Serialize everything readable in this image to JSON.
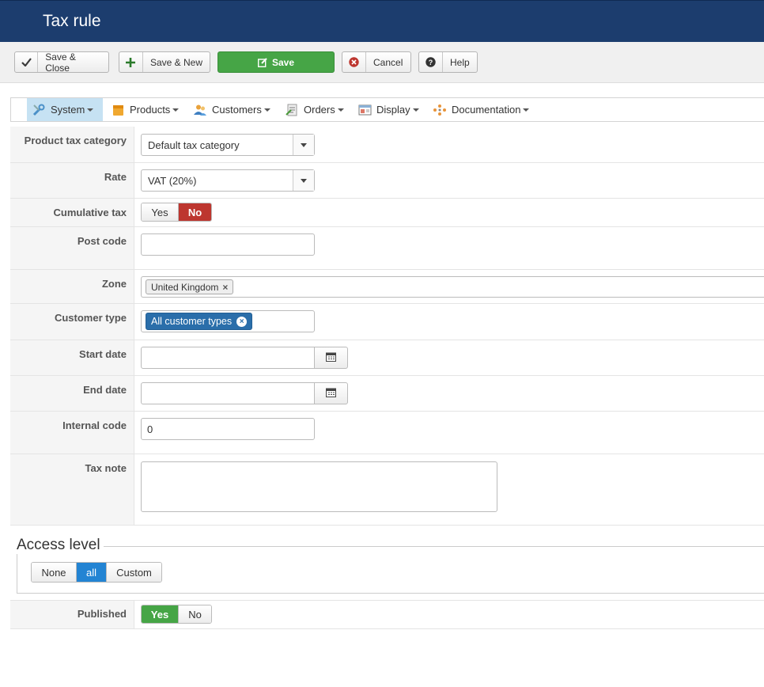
{
  "header": {
    "title": "Tax rule"
  },
  "toolbar": {
    "save_close": "Save & Close",
    "save_new": "Save & New",
    "save": "Save",
    "cancel": "Cancel",
    "help": "Help"
  },
  "menu": {
    "items": [
      {
        "label": "System",
        "icon": "wrench-icon"
      },
      {
        "label": "Products",
        "icon": "box-icon"
      },
      {
        "label": "Customers",
        "icon": "users-icon"
      },
      {
        "label": "Orders",
        "icon": "orders-icon"
      },
      {
        "label": "Display",
        "icon": "display-icon"
      },
      {
        "label": "Documentation",
        "icon": "documentation-icon"
      }
    ],
    "active": "System"
  },
  "form": {
    "product_tax_category": {
      "label": "Product tax category",
      "value": "Default tax category"
    },
    "rate": {
      "label": "Rate",
      "value": "VAT (20%)"
    },
    "cumulative_tax": {
      "label": "Cumulative tax",
      "yes": "Yes",
      "no": "No",
      "selected": "No"
    },
    "post_code": {
      "label": "Post code",
      "value": ""
    },
    "zone": {
      "label": "Zone",
      "selected": [
        "United Kingdom"
      ],
      "remove_glyph": "×"
    },
    "customer_type": {
      "label": "Customer type",
      "selected": [
        "All customer types"
      ],
      "remove_glyph": "×"
    },
    "start_date": {
      "label": "Start date",
      "value": ""
    },
    "end_date": {
      "label": "End date",
      "value": ""
    },
    "internal_code": {
      "label": "Internal code",
      "value": "0"
    },
    "tax_note": {
      "label": "Tax note",
      "value": ""
    }
  },
  "access_level": {
    "legend": "Access level",
    "options": [
      "None",
      "all",
      "Custom"
    ],
    "selected": "all"
  },
  "published": {
    "label": "Published",
    "yes": "Yes",
    "no": "No",
    "selected": "Yes"
  },
  "colors": {
    "header": "#1c3d6e",
    "save_green": "#46a546",
    "no_red": "#bd362f",
    "access_blue": "#2384d3",
    "chip_blue": "#2a6eaa",
    "menu_active": "#c6e2f3"
  }
}
